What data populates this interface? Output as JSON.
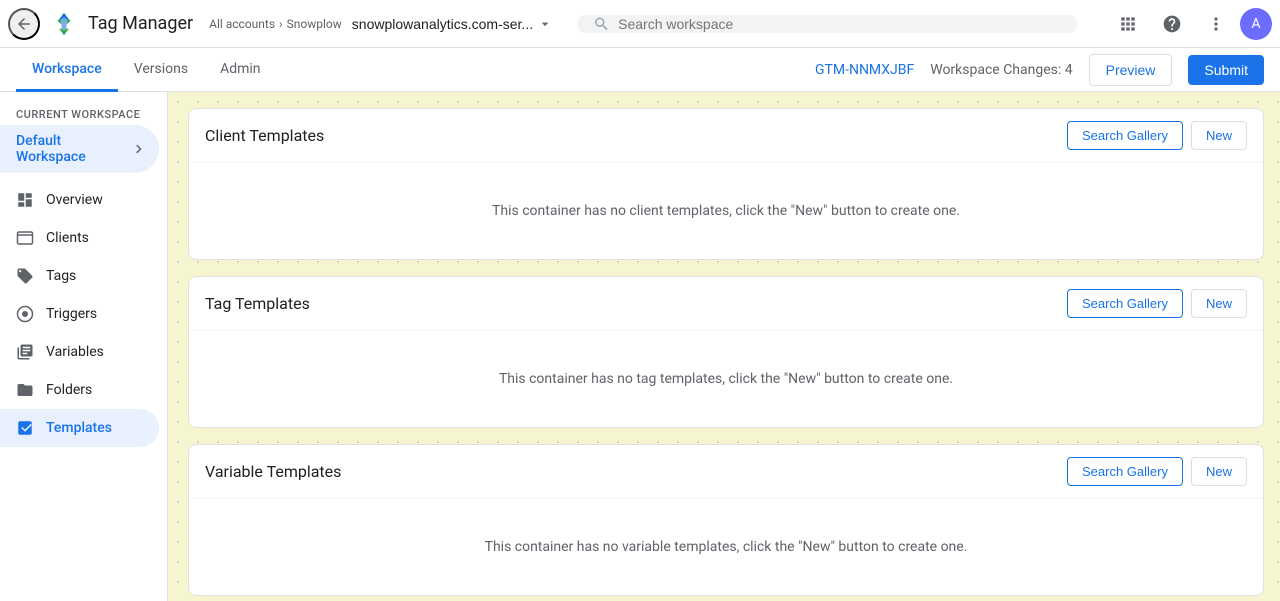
{
  "app": {
    "title": "Tag Manager",
    "back_label": "back"
  },
  "breadcrumb": {
    "all_accounts": "All accounts",
    "separator": "›",
    "account": "Snowplow"
  },
  "workspace_selector": {
    "label": "snowplowanalytics.com-ser...",
    "chevron": "▼"
  },
  "search": {
    "placeholder": "Search workspace"
  },
  "header_icons": {
    "apps": "⊞",
    "help": "?",
    "more": "⋮"
  },
  "sub_header": {
    "tabs": [
      {
        "label": "Workspace",
        "active": true
      },
      {
        "label": "Versions",
        "active": false
      },
      {
        "label": "Admin",
        "active": false
      }
    ],
    "gtm_id": "GTM-NNMXJBF",
    "workspace_changes_label": "Workspace Changes:",
    "workspace_changes_count": "4",
    "preview_label": "Preview",
    "submit_label": "Submit"
  },
  "sidebar": {
    "current_workspace_label": "CURRENT WORKSPACE",
    "workspace_name": "Default Workspace",
    "nav_items": [
      {
        "label": "Overview",
        "icon": "overview"
      },
      {
        "label": "Clients",
        "icon": "clients"
      },
      {
        "label": "Tags",
        "icon": "tags"
      },
      {
        "label": "Triggers",
        "icon": "triggers"
      },
      {
        "label": "Variables",
        "icon": "variables"
      },
      {
        "label": "Folders",
        "icon": "folders"
      },
      {
        "label": "Templates",
        "icon": "templates",
        "active": true
      }
    ]
  },
  "sections": [
    {
      "id": "client-templates",
      "title": "Client Templates",
      "search_gallery_label": "Search Gallery",
      "new_label": "New",
      "empty_message": "This container has no client templates, click the \"New\" button to create one."
    },
    {
      "id": "tag-templates",
      "title": "Tag Templates",
      "search_gallery_label": "Search Gallery",
      "new_label": "New",
      "empty_message": "This container has no tag templates, click the \"New\" button to create one."
    },
    {
      "id": "variable-templates",
      "title": "Variable Templates",
      "search_gallery_label": "Search Gallery",
      "new_label": "New",
      "empty_message": "This container has no variable templates, click the \"New\" button to create one."
    }
  ]
}
